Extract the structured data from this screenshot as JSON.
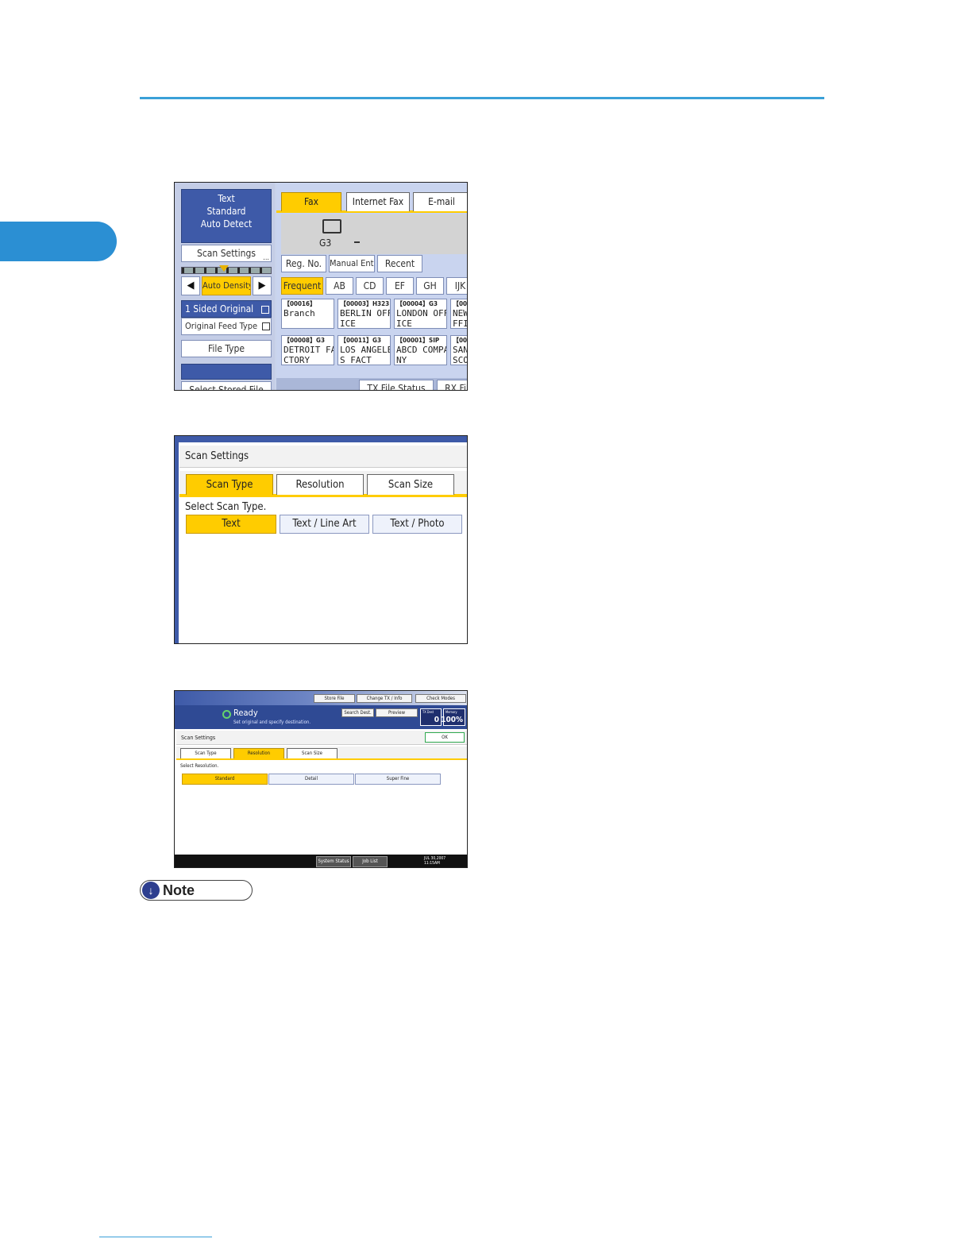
{
  "colors": {
    "accent_blue": "#2b8fd3",
    "rule_blue": "#3aa0d8",
    "panel_blue": "#3e5aa8",
    "highlight_yellow": "#ffcc00"
  },
  "shot1": {
    "info_lines": [
      "Text",
      "Standard",
      "Auto Detect"
    ],
    "scan_settings": "Scan Settings",
    "scan_settings_dots": "...",
    "arrow_left": "◀",
    "arrow_right": "▶",
    "auto_density": "Auto Density",
    "sided_original": "1 Sided Original",
    "original_feed_type": "Original Feed Type",
    "file_type": "File Type",
    "select_stored_file": "Select Stored File",
    "tabs": [
      "Fax",
      "Internet Fax",
      "E-mail"
    ],
    "line_type": "G3",
    "dest_buttons": [
      "Reg. No.",
      "Manual Entry",
      "Recent"
    ],
    "index_tabs": [
      "Frequent",
      "AB",
      "CD",
      "EF",
      "GH",
      "IJK"
    ],
    "entries": [
      {
        "code": "【00016】",
        "line1": "Branch",
        "line2": ""
      },
      {
        "code": "【00003】H323",
        "line1": "BERLIN OFF",
        "line2": "ICE"
      },
      {
        "code": "【00004】G3",
        "line1": "LONDON OFF",
        "line2": "ICE"
      },
      {
        "code": "【00",
        "line1": "NEW",
        "line2": "FFI"
      },
      {
        "code": "【00008】G3",
        "line1": "DETROIT FA",
        "line2": "CTORY"
      },
      {
        "code": "【00011】G3",
        "line1": "LOS ANGELE",
        "line2": "S FACT"
      },
      {
        "code": "【00001】SIP",
        "line1": "ABCD COMPA",
        "line2": "NY"
      },
      {
        "code": "【00",
        "line1": "SAN",
        "line2": "SCO"
      }
    ],
    "bottom_buttons": [
      "TX File Status",
      "RX Fil"
    ]
  },
  "shot2": {
    "title": "Scan Settings",
    "tabs": [
      "Scan Type",
      "Resolution",
      "Scan Size"
    ],
    "prompt": "Select Scan Type.",
    "options": [
      "Text",
      "Text / Line Art",
      "Text / Photo"
    ]
  },
  "shot3": {
    "top_buttons": [
      "Store File",
      "Change TX / Info",
      "Check Modes"
    ],
    "status": "Ready",
    "status_sub": "Set original and specify destination.",
    "search_dest": "Search Dest.",
    "preview": "Preview",
    "tx_label": "TX Dest",
    "tx_value": "0",
    "memory_label": "Memory",
    "memory_value": "100%",
    "title": "Scan Settings",
    "ok": "OK",
    "tabs": [
      "Scan Type",
      "Resolution",
      "Scan Size"
    ],
    "prompt": "Select Resolution.",
    "options": [
      "Standard",
      "Detail",
      "Super Fine"
    ],
    "footer_buttons": [
      "System Status",
      "Job List"
    ],
    "date": "JUL   30,2007",
    "time": "11:15AM"
  },
  "note": {
    "label": "Note",
    "icon": "down-arrow-icon"
  }
}
